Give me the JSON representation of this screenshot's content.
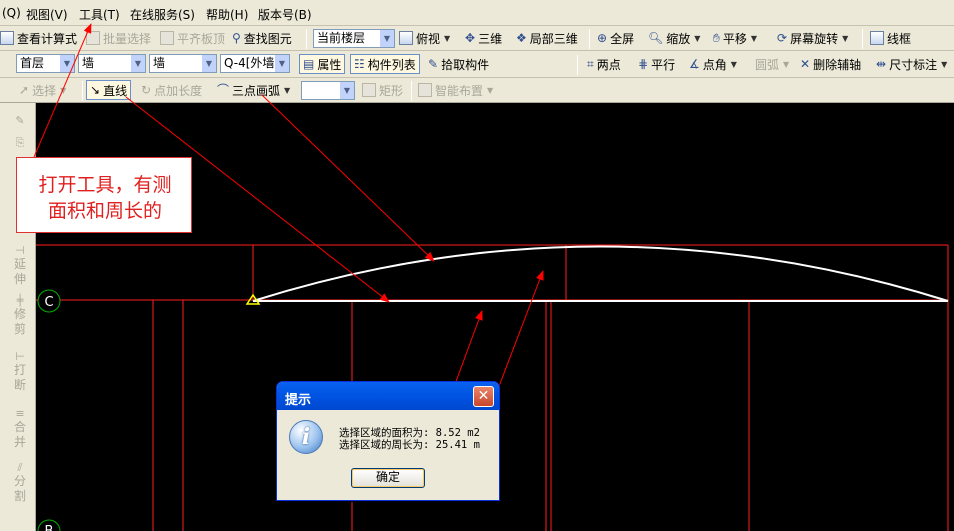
{
  "menubar": {
    "items": [
      "(Q)",
      "视图(V)",
      "工具(T)",
      "在线服务(S)",
      "帮助(H)",
      "版本号(B)"
    ]
  },
  "toolbar1": {
    "view_formula": "查看计算式",
    "batch_select": "批量选择",
    "align_slab_top": "平齐板顶",
    "find_element": "查找图元",
    "floor_combo": "当前楼层",
    "top_view": "俯视",
    "three_d": "三维",
    "local_3d": "局部三维",
    "fullscreen": "全屏",
    "zoom": "缩放",
    "pan": "平移",
    "screen_rotate": "屏幕旋转",
    "wireframe": "线框"
  },
  "toolbar2": {
    "floor_select": "首层",
    "category_select": "墙",
    "type_select": "墙",
    "element_select": "Q-4[外墙]",
    "properties": "属性",
    "element_list": "构件列表",
    "pick_element": "拾取构件",
    "two_points": "两点",
    "parallel": "平行",
    "point_angle": "点角",
    "arc": "圆弧",
    "delete_aux": "删除辅轴",
    "dimension": "尺寸标注"
  },
  "toolbar3": {
    "select": "选择",
    "line": "直线",
    "point_length": "点加长度",
    "three_point_arc": "三点画弧",
    "empty_combo": "",
    "rectangle": "矩形",
    "smart_layout": "智能布置"
  },
  "left_tools": [
    {
      "label": "延伸",
      "icon": "extend-icon"
    },
    {
      "label": "修剪",
      "icon": "trim-icon"
    },
    {
      "label": "打断",
      "icon": "break-icon"
    },
    {
      "label": "合并",
      "icon": "merge-icon"
    },
    {
      "label": "分割",
      "icon": "split-icon"
    }
  ],
  "canvas": {
    "axis_c": "C",
    "axis_b": "B",
    "colors": {
      "background": "#000000",
      "grid_lines": "#ff2020",
      "arc": "#ffffff",
      "marker": "#ffff00",
      "axis_circle": "#00b000"
    }
  },
  "annotation": {
    "line1": "打开工具，有测",
    "line2": "面积和周长的",
    "color": "#e02020"
  },
  "dialog": {
    "title": "提示",
    "close": "✕",
    "line1": "选择区域的面积为: 8.52 m2",
    "line2": "选择区域的周长为: 25.41 m",
    "ok": "确定"
  }
}
